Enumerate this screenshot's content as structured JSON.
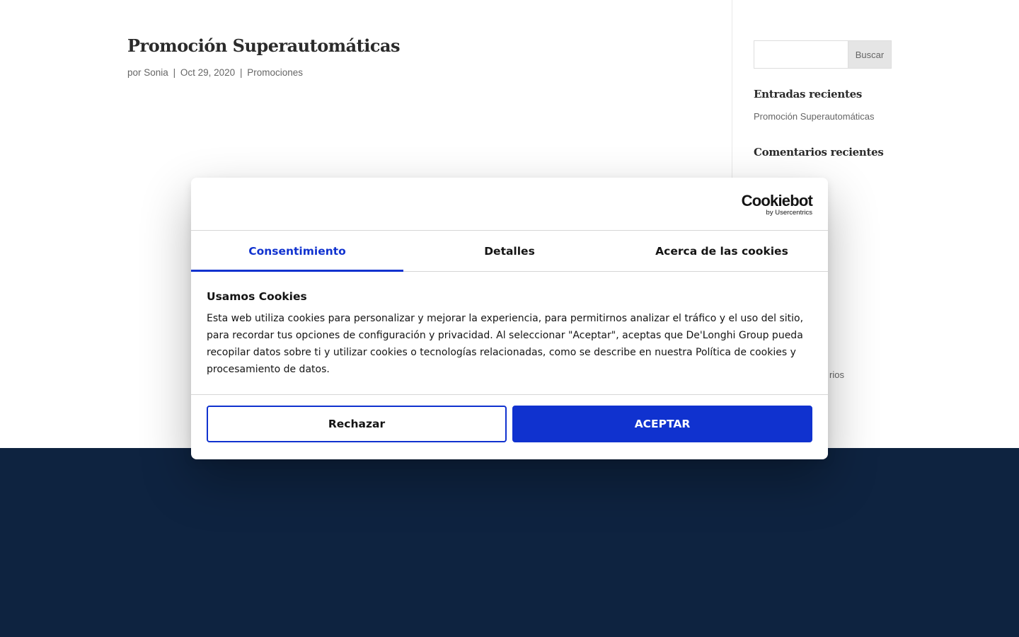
{
  "post": {
    "title": "Promoción Superautomáticas",
    "meta": {
      "prefix": "por",
      "author": "Sonia",
      "date": "Oct 29, 2020",
      "category": "Promociones",
      "separator": "|"
    }
  },
  "sidebar": {
    "search_button": "Buscar",
    "search_value": "",
    "recent_posts_title": "Entradas recientes",
    "recent_posts": [
      "Promoción Superautomáticas"
    ],
    "recent_comments_title": "Comentarios recientes",
    "partial_link": "rios"
  },
  "cookie_dialog": {
    "logo": {
      "main": "Cookiebot",
      "sub": "by Usercentrics"
    },
    "tabs": [
      {
        "label": "Consentimiento",
        "active": true
      },
      {
        "label": "Detalles",
        "active": false
      },
      {
        "label": "Acerca de las cookies",
        "active": false
      }
    ],
    "heading": "Usamos Cookies",
    "body": "Esta web utiliza cookies para personalizar y mejorar la experiencia, para permitirnos analizar el tráfico y el uso del sitio, para recordar tus opciones de configuración y privacidad. Al seleccionar \"Aceptar\", aceptas que De'Longhi Group pueda recopilar datos sobre ti y utilizar cookies o tecnologías relacionadas, como se describe en nuestra Política de cookies y procesamiento de datos.",
    "reject_label": "Rechazar",
    "accept_label": "ACEPTAR"
  },
  "colors": {
    "accent": "#1032cf",
    "footer_band": "#0e2340"
  }
}
